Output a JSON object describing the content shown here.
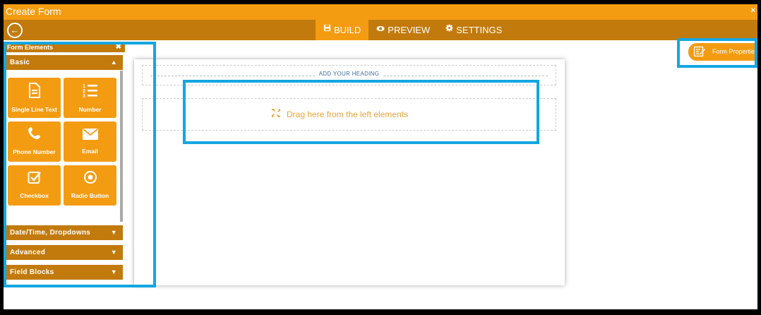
{
  "window": {
    "title": "Create Form",
    "close_label": "×"
  },
  "toolbar": {
    "back_label": "←",
    "tabs": [
      {
        "label": "BUILD",
        "icon": "save-icon",
        "active": true
      },
      {
        "label": "PREVIEW",
        "icon": "eye-icon",
        "active": false
      },
      {
        "label": "SETTINGS",
        "icon": "gear-icon",
        "active": false
      }
    ]
  },
  "sidebar": {
    "header": "Form Elements",
    "sections": [
      {
        "label": "Basic",
        "expanded": true
      },
      {
        "label": "Date/Time, Dropdowns",
        "expanded": false
      },
      {
        "label": "Advanced",
        "expanded": false
      },
      {
        "label": "Field Blocks",
        "expanded": false
      }
    ],
    "basic_elements": [
      {
        "label": "Single Line Text",
        "icon": "document-icon"
      },
      {
        "label": "Number",
        "icon": "numbered-list-icon"
      },
      {
        "label": "Phone Number",
        "icon": "phone-icon"
      },
      {
        "label": "Email",
        "icon": "envelope-icon"
      },
      {
        "label": "Checkbox",
        "icon": "checkbox-icon"
      },
      {
        "label": "Radio Button",
        "icon": "radio-icon"
      }
    ]
  },
  "canvas": {
    "heading_placeholder": "ADD YOUR HEADING",
    "drop_text": "Drag here from the left elements"
  },
  "form_properties": {
    "label": "Form Properties"
  },
  "colors": {
    "accent": "#f39c12",
    "dark_accent": "#c27a0c",
    "highlight": "#14a6e2"
  }
}
